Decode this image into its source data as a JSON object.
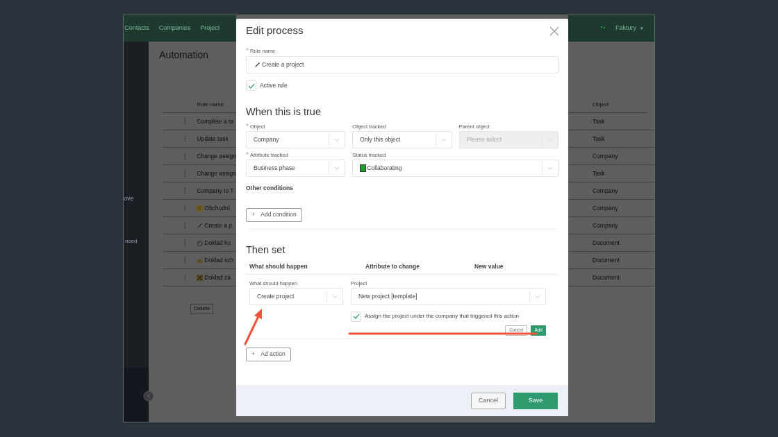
{
  "app": {
    "nav": [
      "Contacts",
      "Companies",
      "Project"
    ],
    "user": {
      "name": "Faktury",
      "caret": "▾"
    },
    "sidebar_texts": [
      "ove",
      "nced"
    ],
    "page_title": "Automation",
    "table": {
      "columns": [
        "Rule name",
        "Object"
      ],
      "rows": [
        {
          "name": "Complete a ta",
          "kind": "plain",
          "object": "Task"
        },
        {
          "name": "Update task",
          "kind": "plain",
          "object": "Task"
        },
        {
          "name": "Change assign",
          "kind": "plain",
          "object": "Company"
        },
        {
          "name": "Change assign",
          "kind": "plain",
          "object": "Task"
        },
        {
          "name": "Company to T",
          "kind": "plain",
          "object": "Company"
        },
        {
          "name": "Obchodní",
          "kind": "badge",
          "object": "Company"
        },
        {
          "name": "Create a p",
          "kind": "pencil",
          "object": "Company"
        },
        {
          "name": "Doklad ko",
          "kind": "timer",
          "object": "Document"
        },
        {
          "name": "Doklad sch",
          "kind": "thumb",
          "object": "Document"
        },
        {
          "name": "Doklad za",
          "kind": "cross",
          "object": "Document"
        }
      ]
    },
    "delete_button": "Delete"
  },
  "dialog": {
    "title": "Edit process",
    "rule_name": {
      "label": "Rule name",
      "required": true,
      "value": "Create a project"
    },
    "active_rule": {
      "label": "Active rule",
      "checked": true
    },
    "conditions": {
      "heading": "When this is true",
      "rows": [
        [
          {
            "label": "Object",
            "required": true,
            "value": "Company",
            "disabled": false
          },
          {
            "label": "Object tracked",
            "required": false,
            "value": "Only this object",
            "disabled": false
          },
          {
            "label": "Parent object",
            "required": false,
            "placeholder": "Please select",
            "disabled": true
          }
        ],
        [
          {
            "label": "Attribute tracked",
            "required": true,
            "value": "Business phase",
            "disabled": false
          },
          {
            "label": "Status tracked",
            "required": false,
            "value": "Collaborating",
            "color": "#1f9e2a",
            "disabled": false
          }
        ]
      ],
      "other_heading": "Other conditions",
      "add_button": "Add condition",
      "add_sign": "+"
    },
    "actions": {
      "heading": "Then set",
      "columns": [
        "What should happen",
        "Attribute to change",
        "New value"
      ],
      "action": {
        "label": "What should happen",
        "value": "Create project"
      },
      "project": {
        "label": "Project",
        "value": "New project [template]"
      },
      "assign": {
        "label": "Assign the project under the company that triggered this action",
        "checked": true
      },
      "cancel": "Cancel",
      "add": "Add",
      "add_action": "Ad action",
      "add_sign": "+"
    },
    "footer": {
      "cancel": "Cancel",
      "save": "Save"
    }
  }
}
